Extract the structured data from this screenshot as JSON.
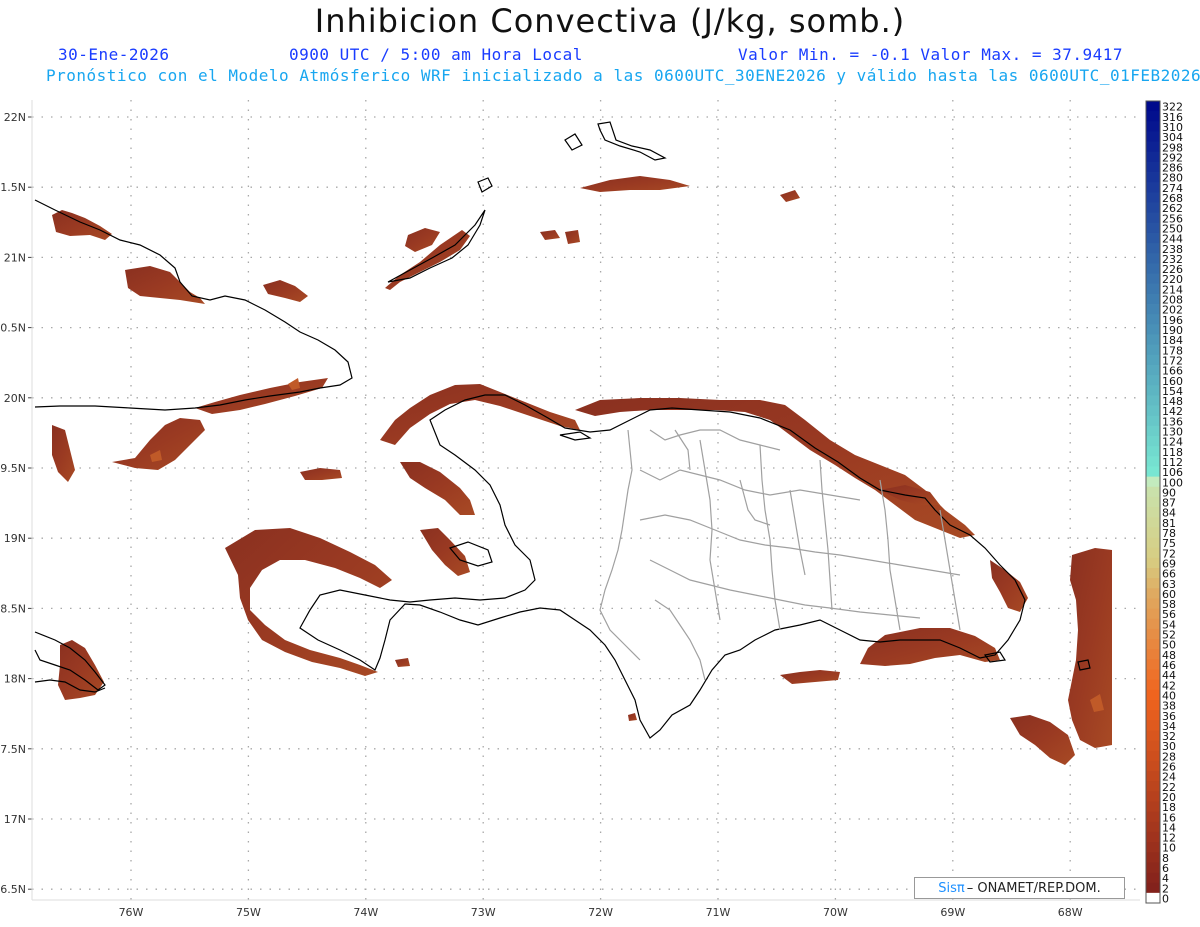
{
  "header": {
    "title": "Inhibicion Convectiva (J/kg, somb.)",
    "date": "30-Ene-2026",
    "time": "0900 UTC / 5:00 am Hora Local",
    "min_max": "Valor Min. = -0.1  Valor Max. = 37.9417",
    "forecast": "Pronóstico con el Modelo Atmósferico WRF inicializado a las 0600UTC_30ENE2026 y válido hasta las  0600UTC_01FEB2026"
  },
  "axes": {
    "lat_labels": [
      "22N",
      "21.5N",
      "21N",
      "20.5N",
      "20N",
      "19.5N",
      "19N",
      "18.5N",
      "18N",
      "17.5N",
      "17N",
      "16.5N"
    ],
    "lon_labels": [
      "76W",
      "75W",
      "74W",
      "73W",
      "72W",
      "71W",
      "70W",
      "69W",
      "68W"
    ]
  },
  "colorbar": {
    "labels": [
      "322",
      "316",
      "310",
      "304",
      "298",
      "292",
      "286",
      "280",
      "274",
      "268",
      "262",
      "256",
      "250",
      "244",
      "238",
      "232",
      "226",
      "220",
      "214",
      "208",
      "202",
      "196",
      "190",
      "184",
      "178",
      "172",
      "166",
      "160",
      "154",
      "148",
      "142",
      "136",
      "130",
      "124",
      "118",
      "112",
      "106",
      "100",
      "90",
      "87",
      "84",
      "81",
      "78",
      "75",
      "72",
      "69",
      "66",
      "63",
      "60",
      "58",
      "56",
      "54",
      "52",
      "50",
      "48",
      "46",
      "44",
      "42",
      "40",
      "38",
      "36",
      "34",
      "32",
      "30",
      "28",
      "26",
      "24",
      "22",
      "20",
      "18",
      "16",
      "14",
      "12",
      "10",
      "8",
      "6",
      "4",
      "2",
      "0"
    ]
  },
  "credit": {
    "sis": "Sisπ",
    "text": "– ONAMET/REP.DOM."
  },
  "colors": {
    "field": "#8b3322",
    "coast": "#000000",
    "provinces": "#a0a0a0",
    "grid": "#a0a0a0"
  }
}
